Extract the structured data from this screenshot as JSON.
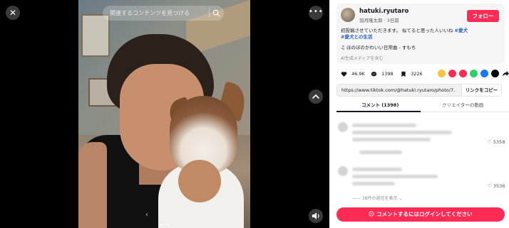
{
  "viewer": {
    "search_placeholder": "関連するコンテンツを見つける",
    "close_icon": "close-icon",
    "more_icon": "more-icon",
    "up_icon": "chevron-up-icon",
    "volume_icon": "volume-icon"
  },
  "author": {
    "username": "hatuki.ryutaro",
    "meta": "羽月隆太郎 · 3日前",
    "follow_label": "フォロー"
  },
  "caption": {
    "text": "初投稿させていただきます。 似てると思った人いいね",
    "tag1": "#愛犬",
    "tag2": "#愛犬との生活"
  },
  "music": {
    "label": "♫ ほのぼのかわいい日常曲 - すもち"
  },
  "ai_label": "AI生成メディアを含む",
  "stats": {
    "likes": "46.9K",
    "comments": "1398",
    "saves": "3226"
  },
  "share": {
    "link": "https://www.tiktok.com/@hatuki.ryutaro/photo/7...",
    "copy_label": "リンクをコピー"
  },
  "tabs": {
    "comments": "コメント (1398)",
    "creator_videos": "クリエイターの動画"
  },
  "comment_items": [
    {
      "likes": "5358"
    },
    {
      "likes": "3536"
    }
  ],
  "replies_label": "38件の返信を表示 ⌄",
  "login_label": "コメントするにはログインしてください",
  "colors": {
    "brand": "#fe2c55",
    "tag": "#2b5db9"
  }
}
